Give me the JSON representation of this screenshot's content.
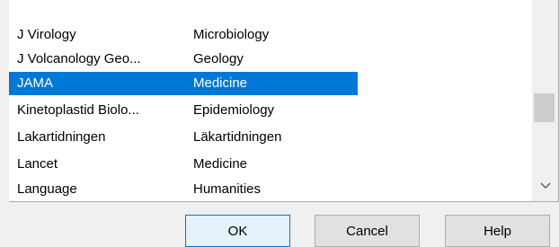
{
  "list": {
    "partial_top_category": "...",
    "rows": [
      {
        "name": "J Virology",
        "category": "Microbiology",
        "selected": false
      },
      {
        "name": "J Volcanology Geo...",
        "category": "Geology",
        "selected": false
      },
      {
        "name": "JAMA",
        "category": "Medicine",
        "selected": true
      },
      {
        "name": "Kinetoplastid Biolo...",
        "category": "Epidemiology",
        "selected": false
      },
      {
        "name": "Lakartidningen",
        "category": "Läkartidningen",
        "selected": false
      },
      {
        "name": "Lancet",
        "category": "Medicine",
        "selected": false
      },
      {
        "name": "Language",
        "category": "Humanities",
        "selected": false
      }
    ],
    "scrollbar": {
      "down_arrow_icon": "chevron-down-icon"
    }
  },
  "buttons": {
    "ok": "OK",
    "cancel": "Cancel",
    "help": "Help"
  },
  "colors": {
    "selection": "#0078d7",
    "default_button_border": "#0078d7"
  }
}
